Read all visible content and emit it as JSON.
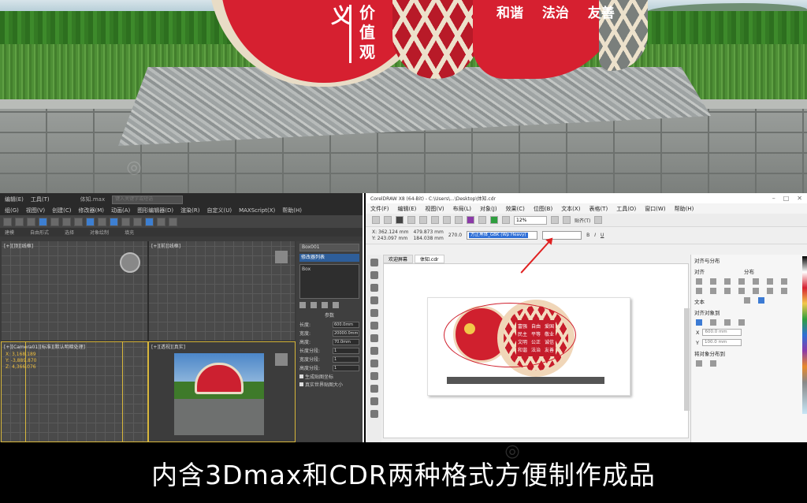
{
  "photo": {
    "sign_char_large": "义",
    "sign_vertical": [
      "价",
      "值",
      "观"
    ],
    "slogans": [
      "和谐",
      "法治",
      "友善"
    ]
  },
  "max_window": {
    "file_title": "体知.max",
    "search_placeholder": "键入关键字或短语",
    "menu_items": [
      "编辑(E)",
      "工具(T)",
      "组(G)",
      "视图(V)",
      "创建(C)",
      "修改器(M)",
      "动画(A)",
      "图形编辑器(D)",
      "渲染(R)",
      "自定义(U)",
      "MAXScript(X)",
      "帮助(H)"
    ],
    "ribbon_items": [
      "建模",
      "自由形式",
      "选择",
      "对象绘制",
      "填充"
    ],
    "viewports": [
      "[+][顶][线框]",
      "[+][前][线框]",
      "[+][Camera01][标准][默认明暗处理]",
      "[+][透视][真实]"
    ],
    "viewport_coords": [
      "X: 3,168.189",
      "Y: -3,889.870",
      "Z: 4,366.076"
    ],
    "cmd_panel": {
      "object_name": "Box001",
      "modifier_list": "修改器列表",
      "stack_item": "Box",
      "rollout": "参数",
      "params": [
        {
          "label": "长度:",
          "value": "600.0mm"
        },
        {
          "label": "宽度:",
          "value": "20000.0mm"
        },
        {
          "label": "高度:",
          "value": "70.0mm"
        },
        {
          "label": "长度分段:",
          "value": "1"
        },
        {
          "label": "宽度分段:",
          "value": "1"
        },
        {
          "label": "高度分段:",
          "value": "1"
        }
      ],
      "checks": [
        "生成贴图坐标",
        "真实世界贴图大小"
      ]
    }
  },
  "cdr_window": {
    "title": "CorelDRAW X8 (64-Bit) - C:\\Users\\...\\Desktop\\体知.cdr",
    "menu": [
      "文件(F)",
      "编辑(E)",
      "视图(V)",
      "布局(L)",
      "对象(J)",
      "效果(C)",
      "位图(B)",
      "文本(X)",
      "表格(T)",
      "工具(O)",
      "窗口(W)",
      "帮助(H)"
    ],
    "zoom": "12%",
    "snap_label": "贴齐(T)",
    "coords": {
      "x": "X: 362.124 mm",
      "y": "Y: 243.097 mm",
      "w": "479.873 mm",
      "h": "184.038 mm"
    },
    "angle": "270.0",
    "font_name": "方正黑体_GBK (Wp Heavy)",
    "tabs": [
      "欢迎屏幕",
      "体知.cdr"
    ],
    "art_words": [
      "富强",
      "自由",
      "爱国",
      "民主",
      "平等",
      "敬业",
      "文明",
      "公正",
      "诚信",
      "和谐",
      "法治",
      "友善"
    ],
    "docker": {
      "title": "对齐与分布",
      "align_label": "对齐",
      "distribute_label": "分布",
      "text_label": "文本",
      "align_objects_to": "对齐对象到",
      "values": [
        "600.0 mm",
        "100.0 mm"
      ],
      "distribute_to": "将对象分布到"
    }
  },
  "caption": "内含3Dmax和CDR两种格式方便制作成品",
  "colors": {
    "sign_red": "#d62030",
    "lattice_cream": "#e8dcc6",
    "caption_bg": "#000000"
  }
}
